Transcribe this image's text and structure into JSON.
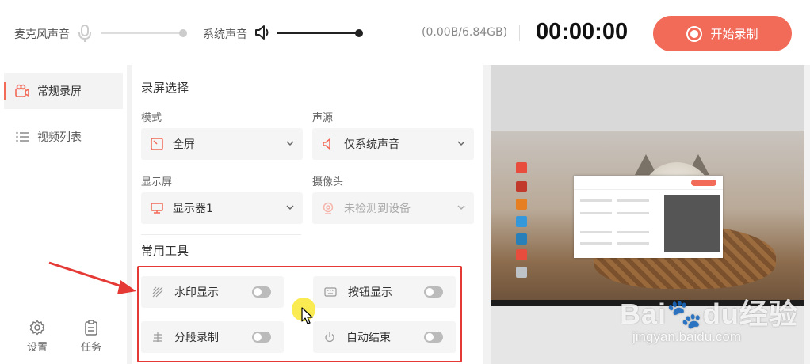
{
  "topbar": {
    "mic_label": "麦克风声音",
    "sys_label": "系统声音",
    "storage": "(0.00B/6.84GB)",
    "timer": "00:00:00",
    "record_button": "开始录制",
    "mic_level": 1.0,
    "sys_level": 1.0
  },
  "sidebar": {
    "items": [
      {
        "label": "常规录屏",
        "icon": "camera-icon",
        "active": true
      },
      {
        "label": "视频列表",
        "icon": "list-icon",
        "active": false
      }
    ],
    "settings_label": "设置",
    "tasks_label": "任务"
  },
  "main": {
    "section_capture": "录屏选择",
    "mode_label": "模式",
    "mode_value": "全屏",
    "audio_label": "声源",
    "audio_value": "仅系统声音",
    "display_label": "显示屏",
    "display_value": "显示器1",
    "camera_label": "摄像头",
    "camera_value": "未检测到设备",
    "section_tools": "常用工具",
    "tools": [
      {
        "label": "水印显示",
        "icon": "watermark-icon",
        "on": false
      },
      {
        "label": "按钮显示",
        "icon": "keyboard-icon",
        "on": false
      },
      {
        "label": "分段录制",
        "icon": "segment-icon",
        "on": false
      },
      {
        "label": "自动结束",
        "icon": "power-icon",
        "on": false
      }
    ]
  },
  "colors": {
    "accent": "#f26a58",
    "highlight_box": "#e53935"
  }
}
